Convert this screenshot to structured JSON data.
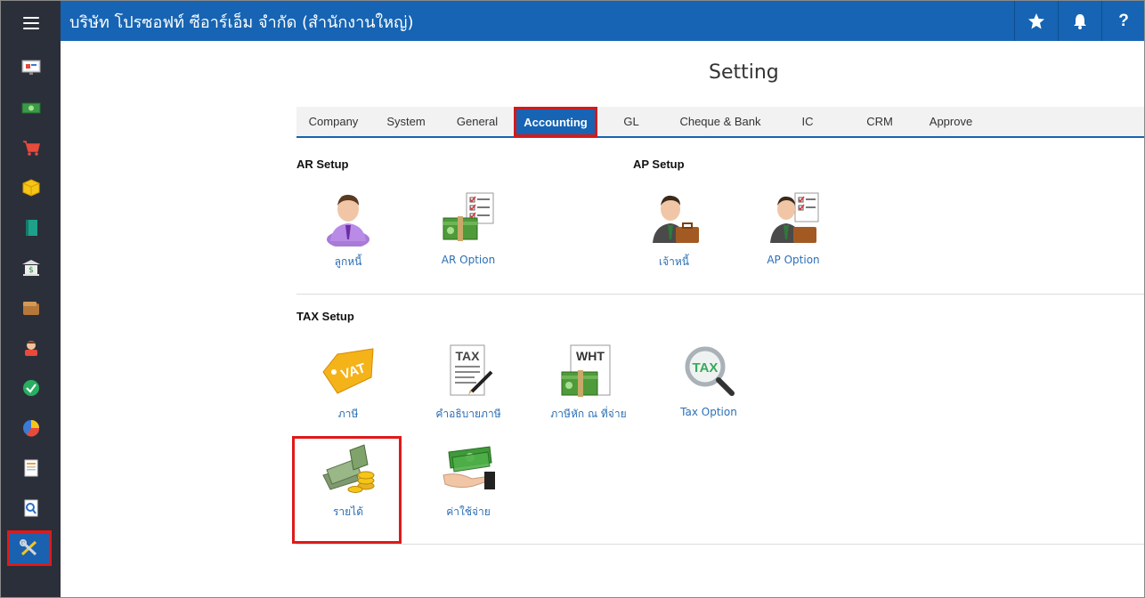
{
  "header": {
    "title": "บริษัท โปรซอฟท์ ซีอาร์เอ็ม จำกัด (สำนักงานใหญ่)",
    "star_icon": "star-icon",
    "bell_icon": "bell-icon",
    "help_label": "?"
  },
  "sidebar": {
    "items": [
      {
        "icon": "menu-icon"
      },
      {
        "icon": "dashboard-icon"
      },
      {
        "icon": "money-icon"
      },
      {
        "icon": "cart-icon"
      },
      {
        "icon": "box-icon"
      },
      {
        "icon": "book-icon"
      },
      {
        "icon": "bank-icon"
      },
      {
        "icon": "wallet-icon"
      },
      {
        "icon": "person-icon"
      },
      {
        "icon": "check-icon"
      },
      {
        "icon": "pie-chart-icon"
      },
      {
        "icon": "document-icon"
      },
      {
        "icon": "search-doc-icon"
      },
      {
        "icon": "tools-icon"
      }
    ],
    "active_index": 13
  },
  "page": {
    "title": "Setting"
  },
  "tabs": [
    {
      "label": "Company"
    },
    {
      "label": "System"
    },
    {
      "label": "General"
    },
    {
      "label": "Accounting"
    },
    {
      "label": "GL"
    },
    {
      "label": "Cheque & Bank"
    },
    {
      "label": "IC"
    },
    {
      "label": "CRM"
    },
    {
      "label": "Approve"
    }
  ],
  "active_tab": "Accounting",
  "ar": {
    "title": "AR Setup",
    "items": [
      {
        "label": "ลูกหนี้",
        "icon": "customer-icon"
      },
      {
        "label": "AR Option",
        "icon": "ar-option-icon"
      }
    ]
  },
  "ap": {
    "title": "AP Setup",
    "items": [
      {
        "label": "เจ้าหนี้",
        "icon": "creditor-icon"
      },
      {
        "label": "AP Option",
        "icon": "ap-option-icon"
      }
    ]
  },
  "tax": {
    "title": "TAX Setup",
    "items": [
      {
        "label": "ภาษี",
        "icon": "vat-icon",
        "badge": "VAT"
      },
      {
        "label": "คำอธิบายภาษี",
        "icon": "tax-doc-icon",
        "badge": "TAX"
      },
      {
        "label": "ภาษีหัก ณ ที่จ่าย",
        "icon": "wht-icon",
        "badge": "WHT"
      },
      {
        "label": "Tax Option",
        "icon": "tax-search-icon",
        "badge": "TAX"
      },
      {
        "label": "รายได้",
        "icon": "income-icon"
      },
      {
        "label": "ค่าใช้จ่าย",
        "icon": "expense-icon"
      }
    ]
  }
}
